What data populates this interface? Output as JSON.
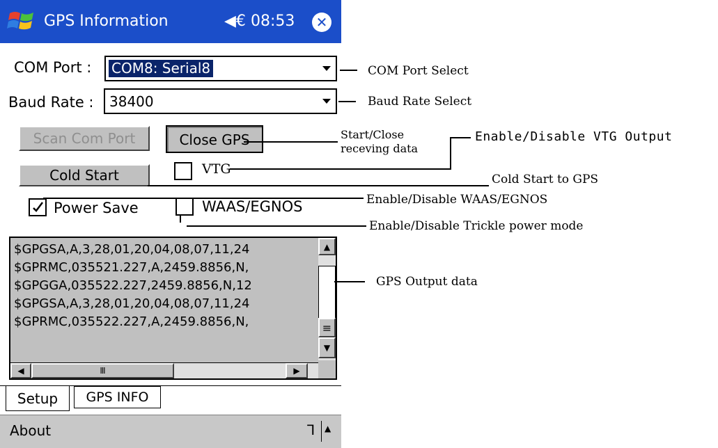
{
  "title_bar": {
    "title": "GPS Information",
    "volume_glyph": "◀€",
    "time": "08:53",
    "close_glyph": "✕"
  },
  "form": {
    "com_port_label": "COM Port :",
    "com_port_value": "COM8:  Serial8",
    "baud_rate_label": "Baud Rate :",
    "baud_rate_value": "38400",
    "scan_button": "Scan Com Port",
    "close_gps_button": "Close GPS",
    "cold_start_button": "Cold Start",
    "vtg_label": "VTG",
    "power_save_label": "Power Save",
    "waas_label": "WAAS/EGNOS"
  },
  "output_log": [
    "$GPGSA,A,3,28,01,20,04,08,07,11,24",
    "$GPRMC,035521.227,A,2459.8856,N,",
    "$GPGGA,035522.227,2459.8856,N,12",
    "$GPGSA,A,3,28,01,20,04,08,07,11,24",
    "$GPRMC,035522.227,A,2459.8856,N,"
  ],
  "scroll_glyphs": {
    "up": "▲",
    "down": "▼",
    "left": "◀",
    "right": "▶",
    "grip_v": "≡",
    "grip_h": "Ⅲ"
  },
  "tabs": [
    "Setup",
    "GPS INFO"
  ],
  "menu_bar": {
    "about": "About",
    "kbd_glyph": "ᒣ",
    "up_glyph": "▲"
  },
  "annotations": {
    "com_port": "COM Port Select",
    "baud_rate": "Baud Rate Select",
    "start_close_line1": "Start/Close",
    "start_close_line2": "receving data",
    "vtg": "Enable/Disable VTG Output",
    "cold_start": "Cold Start to GPS",
    "waas": "Enable/Disable WAAS/EGNOS",
    "trickle": "Enable/Disable Trickle power mode",
    "output": "GPS Output data"
  },
  "colors": {
    "title_bar": "#1b4ec9",
    "selection": "#0a246a",
    "button_face": "#c0c0c0",
    "log_bg": "#c0c0c0"
  }
}
